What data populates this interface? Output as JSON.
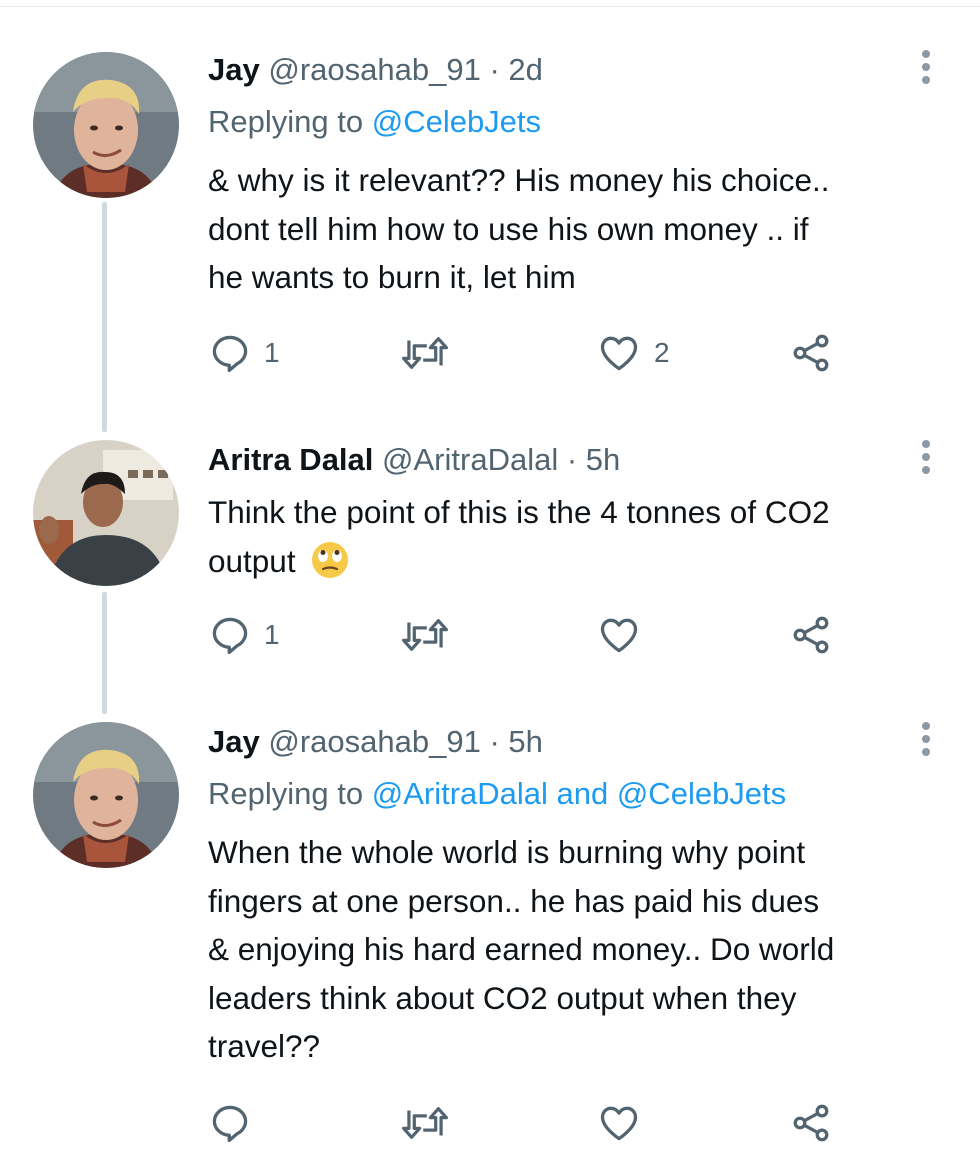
{
  "tweets": [
    {
      "name": "Jay",
      "handle": "@raosahab_91",
      "sep": "·",
      "time": "2d",
      "replying_prefix": "Replying to ",
      "replying_to": "@CelebJets",
      "text_lines": [
        "& why is it relevant?? His money his choice..",
        "dont tell him how to use his own money .. if",
        "he wants to burn it, let him"
      ],
      "reply_count": "1",
      "retweet_count": "",
      "like_count": "2"
    },
    {
      "name": "Aritra Dalal",
      "handle": "@AritraDalal",
      "sep": "·",
      "time": "5h",
      "text_lines": [
        "Think the point of this is the 4 tonnes of CO2",
        "output"
      ],
      "emoji": "face-with-rolling-eyes",
      "reply_count": "1",
      "retweet_count": "",
      "like_count": ""
    },
    {
      "name": "Jay",
      "handle": "@raosahab_91",
      "sep": "·",
      "time": "5h",
      "replying_prefix": "Replying to ",
      "replying_to": "@AritraDalal and @CelebJets",
      "text_lines": [
        "When the whole world is burning why point",
        "fingers at one person.. he has paid his dues",
        "& enjoying his hard earned money.. Do world",
        "leaders think about CO2 output when they",
        "travel??"
      ],
      "reply_count": "",
      "retweet_count": "",
      "like_count": ""
    }
  ],
  "colors": {
    "accent": "#1d9bf0",
    "secondary_text": "#536471",
    "thread_line": "#cfd9de"
  },
  "icons": [
    "reply-icon",
    "retweet-icon",
    "like-icon",
    "share-icon",
    "more-icon"
  ]
}
